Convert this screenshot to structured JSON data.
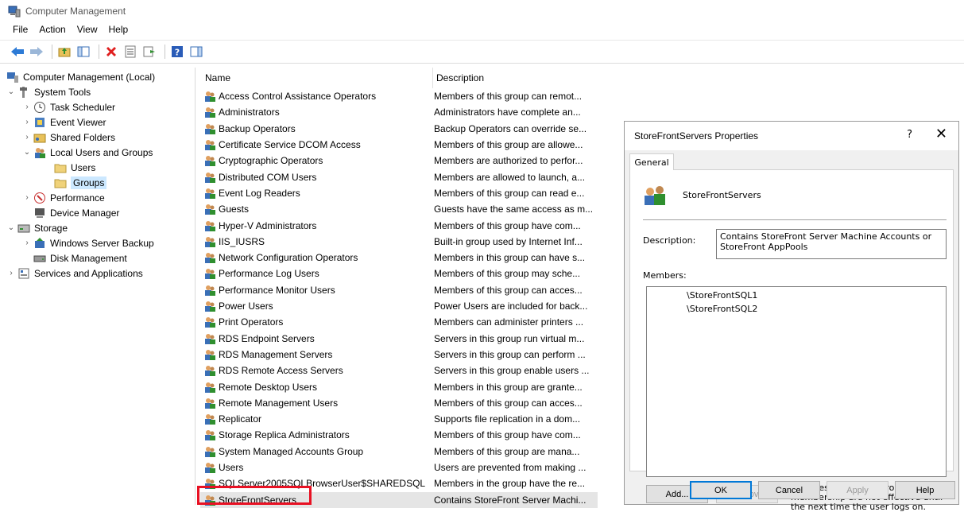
{
  "window": {
    "title": "Computer Management"
  },
  "menu": [
    "File",
    "Action",
    "View",
    "Help"
  ],
  "tree": {
    "root": "Computer Management (Local)",
    "system_tools": "System Tools",
    "task_scheduler": "Task Scheduler",
    "event_viewer": "Event Viewer",
    "shared_folders": "Shared Folders",
    "local_users_groups": "Local Users and Groups",
    "users": "Users",
    "groups": "Groups",
    "performance": "Performance",
    "device_manager": "Device Manager",
    "storage": "Storage",
    "windows_server_backup": "Windows Server Backup",
    "disk_management": "Disk Management",
    "services_apps": "Services and Applications"
  },
  "list": {
    "headers": {
      "name": "Name",
      "description": "Description"
    },
    "rows": [
      {
        "name": "Access Control Assistance Operators",
        "description": "Members of this group can remot..."
      },
      {
        "name": "Administrators",
        "description": "Administrators have complete an..."
      },
      {
        "name": "Backup Operators",
        "description": "Backup Operators can override se..."
      },
      {
        "name": "Certificate Service DCOM Access",
        "description": "Members of this group are allowe..."
      },
      {
        "name": "Cryptographic Operators",
        "description": "Members are authorized to perfor..."
      },
      {
        "name": "Distributed COM Users",
        "description": "Members are allowed to launch, a..."
      },
      {
        "name": "Event Log Readers",
        "description": "Members of this group can read e..."
      },
      {
        "name": "Guests",
        "description": "Guests have the same access as m..."
      },
      {
        "name": "Hyper-V Administrators",
        "description": "Members of this group have com..."
      },
      {
        "name": "IIS_IUSRS",
        "description": "Built-in group used by Internet Inf..."
      },
      {
        "name": "Network Configuration Operators",
        "description": "Members in this group can have s..."
      },
      {
        "name": "Performance Log Users",
        "description": "Members of this group may sche..."
      },
      {
        "name": "Performance Monitor Users",
        "description": "Members of this group can acces..."
      },
      {
        "name": "Power Users",
        "description": "Power Users are included for back..."
      },
      {
        "name": "Print Operators",
        "description": "Members can administer printers ..."
      },
      {
        "name": "RDS Endpoint Servers",
        "description": "Servers in this group run virtual m..."
      },
      {
        "name": "RDS Management Servers",
        "description": "Servers in this group can perform ..."
      },
      {
        "name": "RDS Remote Access Servers",
        "description": "Servers in this group enable users ..."
      },
      {
        "name": "Remote Desktop Users",
        "description": "Members in this group are grante..."
      },
      {
        "name": "Remote Management Users",
        "description": "Members of this group can acces..."
      },
      {
        "name": "Replicator",
        "description": "Supports file replication in a dom..."
      },
      {
        "name": "Storage Replica Administrators",
        "description": "Members of this group have com..."
      },
      {
        "name": "System Managed Accounts Group",
        "description": "Members of this group are mana..."
      },
      {
        "name": "Users",
        "description": "Users are prevented from making ..."
      },
      {
        "name": "SQLServer2005SQLBrowserUser$SHAREDSQL",
        "description": "Members in the group have the re..."
      },
      {
        "name": "StoreFrontServers",
        "description": "Contains StoreFront Server Machi..."
      }
    ]
  },
  "dialog": {
    "title": "StoreFrontServers Properties",
    "help": "?",
    "close": "✕",
    "tab": "General",
    "group_name": "StoreFrontServers",
    "description_label": "Description:",
    "description_value": "Contains StoreFront Server Machine Accounts or StoreFront AppPools",
    "members_label": "Members:",
    "members": [
      "\\StoreFrontSQL1",
      "\\StoreFrontSQL2"
    ],
    "add": "Add...",
    "remove": "Remove",
    "note": "Changes to a user's group membership are not effective until the next time the user logs on.",
    "ok": "OK",
    "cancel": "Cancel",
    "apply": "Apply",
    "help_button": "Help"
  }
}
